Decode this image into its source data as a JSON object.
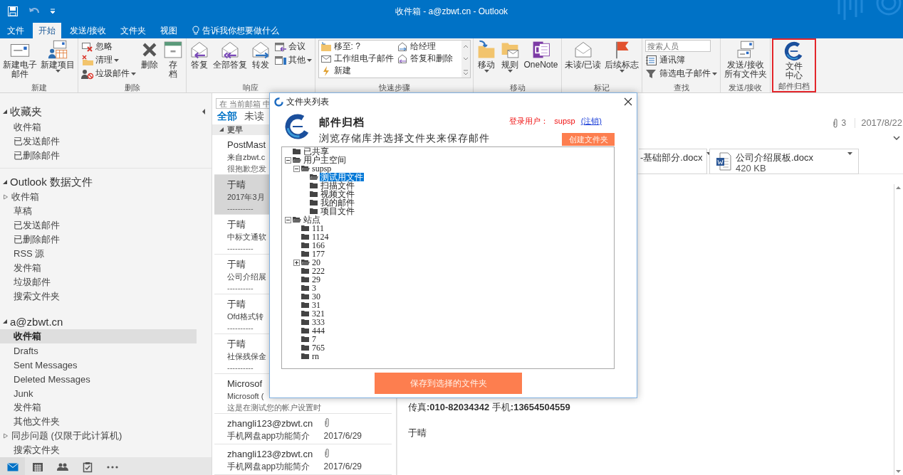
{
  "window": {
    "title": "收件箱 - a@zbwt.cn - Outlook"
  },
  "ribbon_tabs": [
    {
      "label": "文件",
      "selected": false
    },
    {
      "label": "开始",
      "selected": true
    },
    {
      "label": "发送/接收",
      "selected": false
    },
    {
      "label": "文件夹",
      "selected": false
    },
    {
      "label": "视图",
      "selected": false
    }
  ],
  "tell_me": {
    "placeholder": "告诉我你想要做什么"
  },
  "ribbon": {
    "groups": [
      {
        "label": "新建",
        "controls": [
          {
            "kind": "large",
            "label": "新建电子邮件",
            "menu": false
          },
          {
            "kind": "large",
            "label": "新建项目",
            "menu": true
          }
        ]
      },
      {
        "label": "删除",
        "controls": [
          {
            "kind": "stack",
            "items": [
              {
                "kind": "button",
                "label": "忽略",
                "menu": false
              },
              {
                "kind": "button",
                "label": "清理",
                "menu": true
              },
              {
                "kind": "button",
                "label": "垃圾邮件",
                "menu": true
              }
            ]
          },
          {
            "kind": "large",
            "label": "删除",
            "menu": false
          },
          {
            "kind": "large",
            "label": "存档",
            "menu": false
          }
        ]
      },
      {
        "label": "响应",
        "controls": [
          {
            "kind": "large",
            "label": "答复",
            "menu": false
          },
          {
            "kind": "large",
            "label": "全部答复",
            "menu": false
          },
          {
            "kind": "large",
            "label": "转发",
            "menu": false
          },
          {
            "kind": "stack",
            "items": [
              {
                "kind": "button",
                "label": "会议",
                "menu": false
              },
              {
                "kind": "button",
                "label": "其他",
                "menu": true
              }
            ]
          }
        ]
      },
      {
        "label": "快速步骤",
        "controls": [
          {
            "kind": "gallery",
            "items": [
              {
                "label": "移至: ?"
              },
              {
                "label": "工作组电子邮件"
              },
              {
                "label": "新建"
              },
              {
                "label": "给经理"
              },
              {
                "label": "答复和删除"
              }
            ]
          }
        ]
      },
      {
        "label": "移动",
        "controls": [
          {
            "kind": "large",
            "label": "移动",
            "menu": true
          },
          {
            "kind": "large",
            "label": "规则",
            "menu": true
          },
          {
            "kind": "large",
            "label": "OneNote",
            "menu": false
          }
        ]
      },
      {
        "label": "标记",
        "controls": [
          {
            "kind": "large",
            "label": "未读/已读",
            "menu": false
          },
          {
            "kind": "large",
            "label": "后续标志",
            "menu": true
          }
        ]
      },
      {
        "label": "查找",
        "controls": [
          {
            "kind": "stack",
            "items": [
              {
                "kind": "search",
                "placeholder": "搜索人员"
              },
              {
                "kind": "button",
                "label": "通讯簿",
                "menu": false
              },
              {
                "kind": "button",
                "label": "筛选电子邮件",
                "menu": true
              }
            ]
          }
        ]
      },
      {
        "label": "发送/接收",
        "controls": [
          {
            "kind": "large",
            "label": "发送/接收所有文件夹",
            "menu": false
          }
        ]
      },
      {
        "label": "邮件归档",
        "highlighted": true,
        "controls": [
          {
            "kind": "large",
            "label": "文件中心",
            "menu": false
          }
        ]
      }
    ]
  },
  "folder_pane": {
    "sections": [
      {
        "name": "收藏夹",
        "expanded": true,
        "folders": [
          {
            "name": "收件箱",
            "selected": false
          },
          {
            "name": "已发送邮件",
            "selected": false
          },
          {
            "name": "已删除邮件",
            "selected": false
          }
        ]
      },
      {
        "name": "Outlook 数据文件",
        "expanded": true,
        "folders": [
          {
            "name": "收件箱",
            "selected": false,
            "expanded": false
          },
          {
            "name": "草稿",
            "selected": false
          },
          {
            "name": "已发送邮件",
            "selected": false
          },
          {
            "name": "已删除邮件",
            "selected": false
          },
          {
            "name": "RSS 源",
            "selected": false
          },
          {
            "name": "发件箱",
            "selected": false
          },
          {
            "name": "垃圾邮件",
            "selected": false
          },
          {
            "name": "搜索文件夹",
            "selected": false
          }
        ]
      },
      {
        "name": "a@zbwt.cn",
        "expanded": true,
        "folders": [
          {
            "name": "收件箱",
            "selected": true
          },
          {
            "name": "Drafts",
            "selected": false
          },
          {
            "name": "Sent Messages",
            "selected": false
          },
          {
            "name": "Deleted Messages",
            "selected": false
          },
          {
            "name": "Junk",
            "selected": false
          },
          {
            "name": "发件箱",
            "selected": false
          },
          {
            "name": "其他文件夹",
            "selected": false
          },
          {
            "name": "同步问题 (仅限于此计算机)",
            "selected": false,
            "expanded": false
          },
          {
            "name": "搜索文件夹",
            "selected": false
          }
        ]
      }
    ],
    "bottom_nav": [
      {
        "selected": true
      },
      {
        "selected": false
      },
      {
        "selected": false
      },
      {
        "selected": false
      },
      {
        "selected": false
      }
    ]
  },
  "message_list": {
    "search": {
      "placeholder": "在 当前邮箱 中"
    },
    "filters": [
      {
        "label": "全部",
        "selected": true
      },
      {
        "label": "未读",
        "selected": false
      }
    ],
    "group": {
      "label": "更早",
      "expanded": true
    },
    "messages": [
      {
        "sender": "PostMast",
        "subject": "来自zbwt.c",
        "preview": "很抱歉您发",
        "selected": false
      },
      {
        "sender": "于晴",
        "subject": "2017年3月",
        "preview": "----------",
        "selected": true
      },
      {
        "sender": "于晴",
        "subject": "中标文通软",
        "preview": "----------",
        "selected": false
      },
      {
        "sender": "于晴",
        "subject": "公司介绍展",
        "preview": "----------",
        "selected": false
      },
      {
        "sender": "于晴",
        "subject": "Ofd格式转",
        "preview": "----------",
        "selected": false
      },
      {
        "sender": "于晴",
        "subject": "社保残保金",
        "preview": "----------",
        "selected": false
      },
      {
        "sender": "Microsof",
        "subject": "Microsoft (",
        "preview": "这是在测试您的帐户设置时",
        "selected": false
      },
      {
        "sender": "zhangli123@zbwt.cn",
        "subject": "手机网盘app功能简介",
        "date": "2017/6/29",
        "attachment": true,
        "selected": false
      },
      {
        "sender": "zhangli123@zbwt.cn",
        "subject": "手机网盘app功能简介",
        "date": "2017/6/29",
        "attachment": true,
        "selected": false
      }
    ]
  },
  "reading_pane": {
    "attachment_count": "3",
    "date": "2017/8/22",
    "attachments": [
      {
        "name": "-基础部分.docx",
        "cut": true
      },
      {
        "name": "公司介绍展板.docx",
        "size": "420 KB",
        "cut": false
      }
    ],
    "body": [
      "传真**:010-82034342**  手机**:13654504559**",
      "于晴"
    ]
  },
  "dialog": {
    "title": "文件夹列表",
    "heading": "邮件归档",
    "subheading": "浏览存储库并选择文件夹来保存邮件",
    "user_label": "登录用户：",
    "user": "supsp",
    "logout_link": "(注销)",
    "create_button": "创建文件夹",
    "tree": [
      {
        "label": "已共享",
        "selected": false
      },
      {
        "label": "用户主空间",
        "expanded": true,
        "selected": false,
        "children": [
          {
            "label": "supsp",
            "expanded": true,
            "selected": false,
            "children": [
              {
                "label": "测试用文件",
                "selected": true
              },
              {
                "label": "扫描文件",
                "selected": false
              },
              {
                "label": "视频文件",
                "selected": false
              },
              {
                "label": "我的邮件",
                "selected": false
              },
              {
                "label": "项目文件",
                "selected": false
              }
            ]
          }
        ]
      },
      {
        "label": "站点",
        "expanded": true,
        "selected": false,
        "children": [
          {
            "label": "111",
            "selected": false
          },
          {
            "label": "1124",
            "selected": false
          },
          {
            "label": "166",
            "selected": false
          },
          {
            "label": "177",
            "selected": false
          },
          {
            "label": "20",
            "expanded": false,
            "selected": false
          },
          {
            "label": "222",
            "selected": false
          },
          {
            "label": "29",
            "selected": false
          },
          {
            "label": "3",
            "selected": false
          },
          {
            "label": "30",
            "selected": false
          },
          {
            "label": "31",
            "selected": false
          },
          {
            "label": "321",
            "selected": false
          },
          {
            "label": "333",
            "selected": false
          },
          {
            "label": "444",
            "selected": false
          },
          {
            "label": "7",
            "selected": false
          },
          {
            "label": "765",
            "selected": false
          },
          {
            "label": "rn",
            "selected": false
          }
        ]
      }
    ],
    "save_button": "保存到选择的文件夹"
  }
}
